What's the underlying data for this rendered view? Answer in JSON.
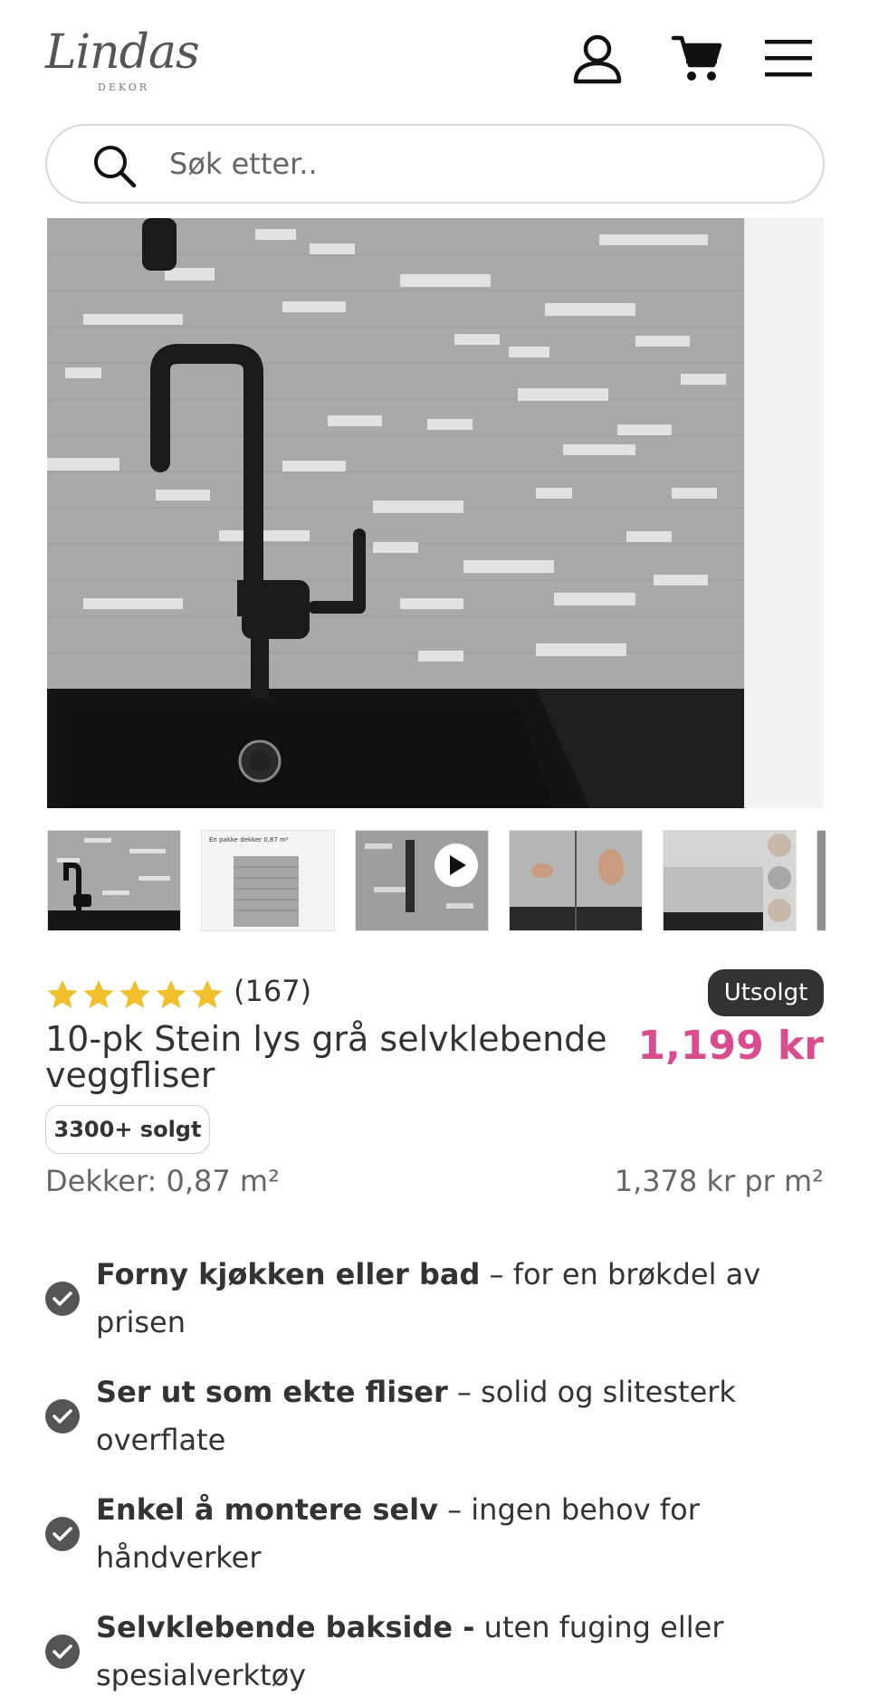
{
  "header": {
    "logo_text": "Lindas",
    "logo_sub": "DEKOR",
    "icons": [
      "account-icon",
      "cart-icon",
      "menu-icon"
    ]
  },
  "search": {
    "placeholder": "Søk etter.."
  },
  "gallery": {
    "thumbnail_1_caption": "En pakke dekker 0,87 m²"
  },
  "product": {
    "rating_stars": 5,
    "reviews": "(167)",
    "status_badge": "Utsolgt",
    "title": "10-pk Stein lys grå selvklebende veggfliser",
    "price": "1,199 kr",
    "sold_badge": "3300+ solgt",
    "coverage": "Dekker: 0,87 m²",
    "price_per_m2": "1,378 kr pr m²"
  },
  "benefits": [
    {
      "bold": "Forny kjøkken eller bad",
      "rest": " – for en brøkdel av prisen"
    },
    {
      "bold": "Ser ut som ekte fliser",
      "rest": " – solid og slitesterk overflate"
    },
    {
      "bold": "Enkel å montere selv",
      "rest": " – ingen behov for håndverker"
    },
    {
      "bold": "Selvklebende bakside -",
      "rest": " uten fuging eller spesialverktøy"
    }
  ],
  "colors": {
    "price": "#d94c8f",
    "star": "#f2c02c",
    "badge_bg": "#333333",
    "check": "#555555"
  }
}
